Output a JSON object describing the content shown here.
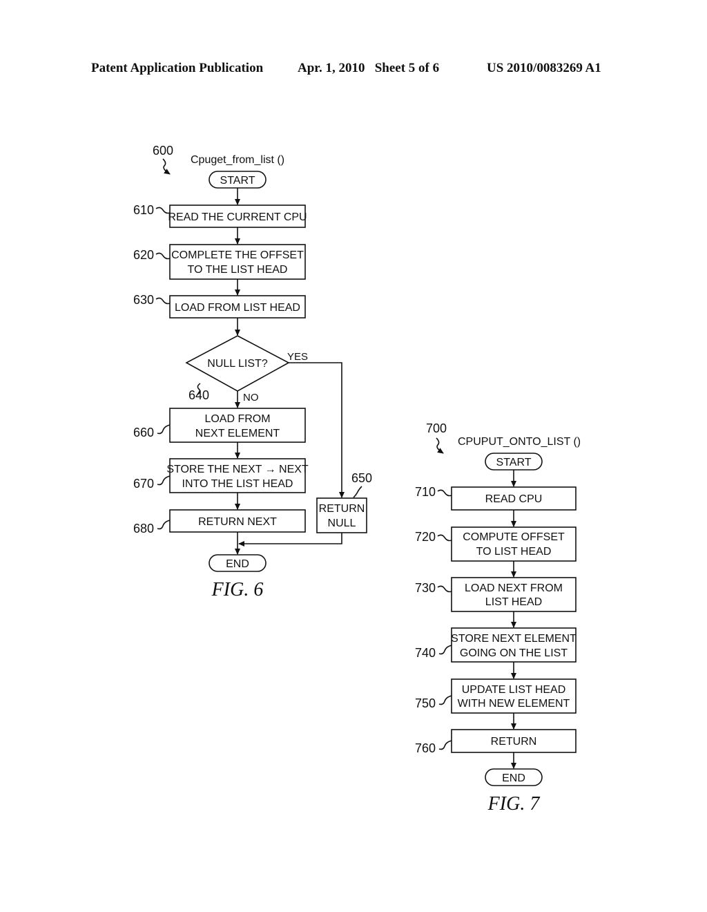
{
  "header": {
    "publication": "Patent Application Publication",
    "date_sheet": "Apr. 1, 2010   Sheet 5 of 6",
    "number": "US 2010/0083269 A1"
  },
  "fig6": {
    "ref": "600",
    "function_name": "Cpuget_from_list ()",
    "start": "START",
    "end": "END",
    "caption": "FIG. 6",
    "steps": [
      {
        "ref": "610",
        "lines": [
          "READ THE CURRENT CPU"
        ]
      },
      {
        "ref": "620",
        "lines": [
          "COMPLETE THE OFFSET",
          "TO THE LIST HEAD"
        ]
      },
      {
        "ref": "630",
        "lines": [
          "LOAD FROM LIST HEAD"
        ]
      },
      {
        "ref": "660",
        "lines": [
          "LOAD FROM",
          "NEXT ELEMENT"
        ]
      },
      {
        "ref": "670",
        "lines": [
          "STORE THE NEXT → NEXT",
          "INTO THE LIST HEAD"
        ]
      },
      {
        "ref": "680",
        "lines": [
          "RETURN NEXT"
        ]
      }
    ],
    "decision": {
      "ref": "640",
      "text": "NULL LIST?",
      "yes": "YES",
      "no": "NO"
    },
    "null_return": {
      "ref": "650",
      "lines": [
        "RETURN",
        "NULL"
      ]
    }
  },
  "fig7": {
    "ref": "700",
    "function_name": "CPUPUT_ONTO_LIST ()",
    "start": "START",
    "end": "END",
    "caption": "FIG. 7",
    "steps": [
      {
        "ref": "710",
        "lines": [
          "READ CPU"
        ]
      },
      {
        "ref": "720",
        "lines": [
          "COMPUTE OFFSET",
          "TO LIST HEAD"
        ]
      },
      {
        "ref": "730",
        "lines": [
          "LOAD NEXT FROM",
          "LIST HEAD"
        ]
      },
      {
        "ref": "740",
        "lines": [
          "STORE NEXT ELEMENT",
          "GOING ON THE LIST"
        ]
      },
      {
        "ref": "750",
        "lines": [
          "UPDATE LIST HEAD",
          "WITH NEW ELEMENT"
        ]
      },
      {
        "ref": "760",
        "lines": [
          "RETURN"
        ]
      }
    ]
  }
}
